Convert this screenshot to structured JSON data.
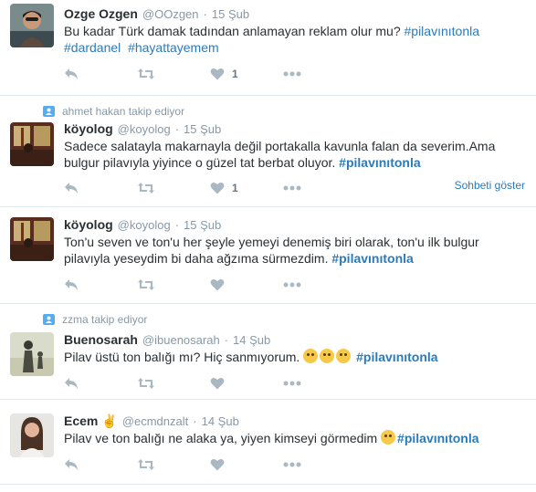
{
  "tweets": [
    {
      "name": "Ozge Ozgen",
      "handle": "@OOzgen",
      "time": "15 Şub",
      "text": "Bu kadar Türk damak tadından anlamayan reklam olur mu? ",
      "hashtags": [
        "#pilavınıtonla",
        "#dardanel",
        "#hayattayemem"
      ],
      "likes": "1"
    },
    {
      "context": "ahmet hakan takip ediyor",
      "name": "köyolog",
      "handle": "@koyolog",
      "time": "15 Şub",
      "text": "Sadece salatayla makarnayla değil portakalla kavunla falan da severim.Ama bulgur pilavıyla yiyince o güzel tat berbat oluyor. ",
      "hashtag": "#pilavınıtonla",
      "likes": "1",
      "show_conversation": "Sohbeti göster"
    },
    {
      "name": "köyolog",
      "handle": "@koyolog",
      "time": "15 Şub",
      "text": "Ton'u seven ve ton'u her şeyle yemeyi denemiş biri olarak, ton'u ilk bulgur pilavıyla yeseydim bi daha ağzıma sürmezdim. ",
      "hashtag": "#pilavınıtonla"
    },
    {
      "context": "zzma takip ediyor",
      "name": "Buenosarah",
      "handle": "@ibuenosarah",
      "time": "14 Şub",
      "text": "Pilav üstü ton balığı mı? Hiç sanmıyorum. ",
      "hashtag": "#pilavınıtonla"
    },
    {
      "name": "Ecem",
      "handle": "@ecmdnzalt",
      "time": "14 Şub",
      "text": "Pilav ve ton balığı ne alaka ya, yiyen kimseyi görmedim ",
      "hashtag": "#pilavınıtonla"
    }
  ],
  "separator": "·",
  "icons": {
    "reply": "reply-icon",
    "retweet": "retweet-icon",
    "like": "heart-icon",
    "more": "more-icon",
    "follow": "person-icon"
  },
  "colors": {
    "link": "#2b7bb9",
    "muted": "#8899a6",
    "icon": "#aab8c2",
    "text": "#292f33"
  }
}
